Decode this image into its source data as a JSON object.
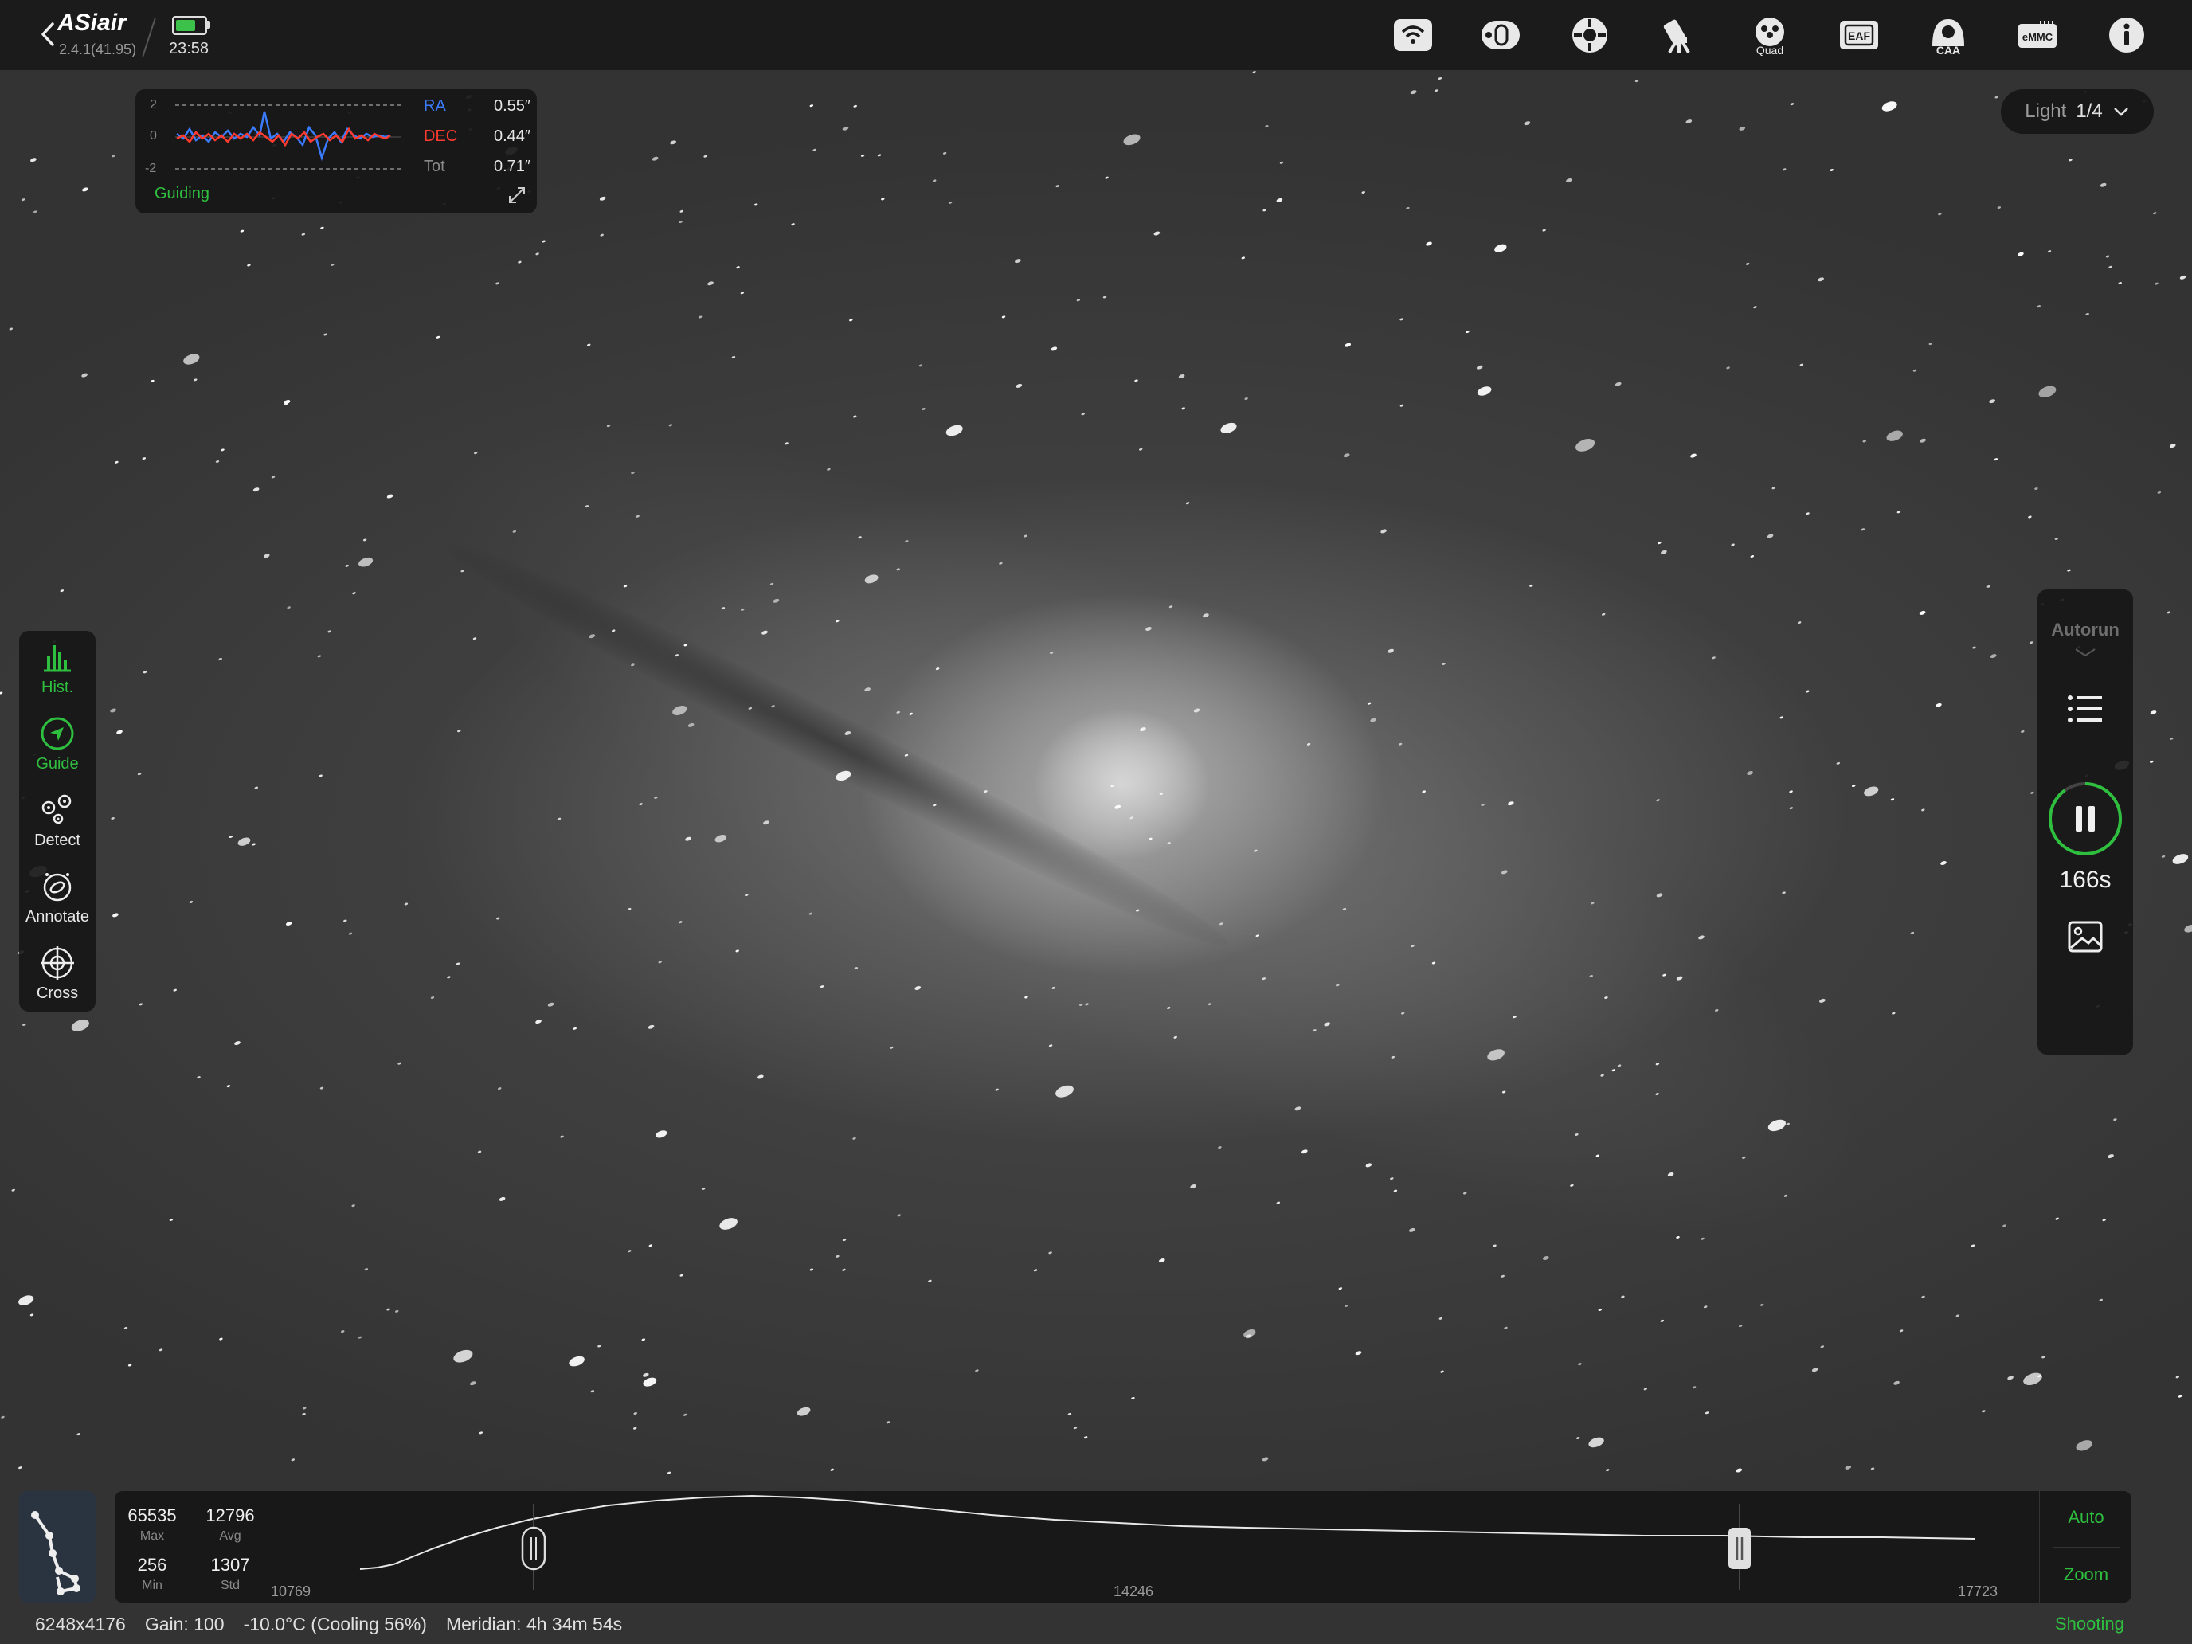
{
  "app": {
    "name": "ASiair",
    "version": "2.4.1(41.95)",
    "clock": "23:58"
  },
  "topbar_icons": [
    "wifi-icon",
    "filter-wheel-icon",
    "mount-icon",
    "telescope-icon",
    "quad-icon",
    "eaf-icon",
    "caa-icon",
    "emmc-icon",
    "info-icon"
  ],
  "topbar_icon_text": {
    "quad": "Quad",
    "eaf": "EAF",
    "caa": "CAA",
    "emmc": "eMMC"
  },
  "guide": {
    "axis": [
      "2",
      "0",
      "-2"
    ],
    "stats": [
      {
        "label": "RA",
        "value": "0.55″",
        "color": "#3a7bff"
      },
      {
        "label": "DEC",
        "value": "0.44″",
        "color": "#ff3b30"
      },
      {
        "label": "Tot",
        "value": "0.71″",
        "color": "#8a8a8a"
      }
    ],
    "status": "Guiding"
  },
  "frame": {
    "type": "Light",
    "count": "1/4"
  },
  "tools": [
    {
      "label": "Hist.",
      "icon": "histogram-icon",
      "active": true
    },
    {
      "label": "Guide",
      "icon": "guide-icon",
      "active": true
    },
    {
      "label": "Detect",
      "icon": "detect-stars-icon",
      "active": false
    },
    {
      "label": "Annotate",
      "icon": "annotate-icon",
      "active": false
    },
    {
      "label": "Cross",
      "icon": "crosshair-icon",
      "active": false
    }
  ],
  "autorun": {
    "label": "Autorun",
    "countdown": "166s",
    "progress": 0.9
  },
  "histogram": {
    "max_value": "65535",
    "max_label": "Max",
    "avg_value": "12796",
    "avg_label": "Avg",
    "min_value": "256",
    "min_label": "Min",
    "std_value": "1307",
    "std_label": "Std",
    "tick_left": "10769",
    "tick_mid": "14246",
    "tick_right": "17723",
    "auto_label": "Auto",
    "zoom_label": "Zoom"
  },
  "status": {
    "resolution": "6248x4176",
    "gain": "Gain: 100",
    "temperature": "-10.0°C (Cooling 56%)",
    "meridian": "Meridian: 4h 34m 54s",
    "state": "Shooting"
  },
  "colors": {
    "accent": "#2fbf3f",
    "ra": "#3a7bff",
    "dec": "#ff3b30",
    "topbar": "#1b1b1b"
  }
}
